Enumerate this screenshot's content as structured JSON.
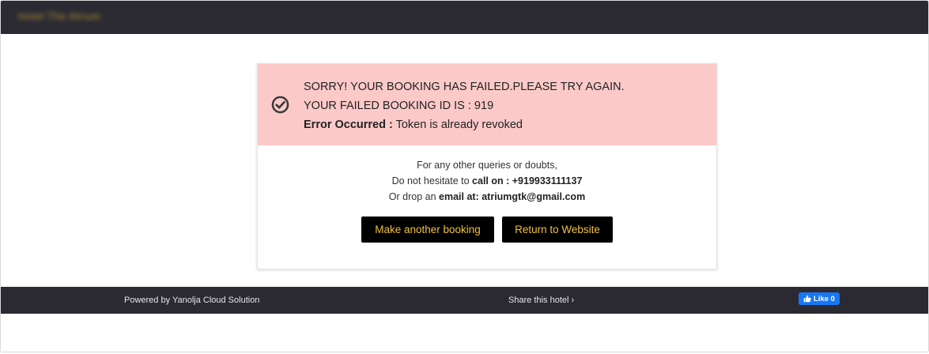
{
  "header": {
    "brand": "Hotel The Atrium"
  },
  "alert": {
    "line1": "SORRY! YOUR BOOKING HAS FAILED.PLEASE TRY AGAIN.",
    "line2": "YOUR FAILED BOOKING ID IS : 919",
    "error_label": "Error Occurred :",
    "error_text": " Token is already revoked",
    "background_color": "#fcc9c9"
  },
  "contact": {
    "intro": "For any other queries or doubts,",
    "call_prefix": "Do not hesitate to ",
    "call_label": "call on : +919933111137",
    "email_prefix": "Or drop an ",
    "email_label": "email at: atriumgtk@gmail.com"
  },
  "buttons": {
    "make_booking": "Make another booking",
    "return_site": "Return to Website",
    "text_color": "#f0c040"
  },
  "footer": {
    "powered": "Powered by Yanolja Cloud Solution",
    "share": "Share this hotel",
    "share_arrow": "›",
    "like_label": "Like 0"
  }
}
